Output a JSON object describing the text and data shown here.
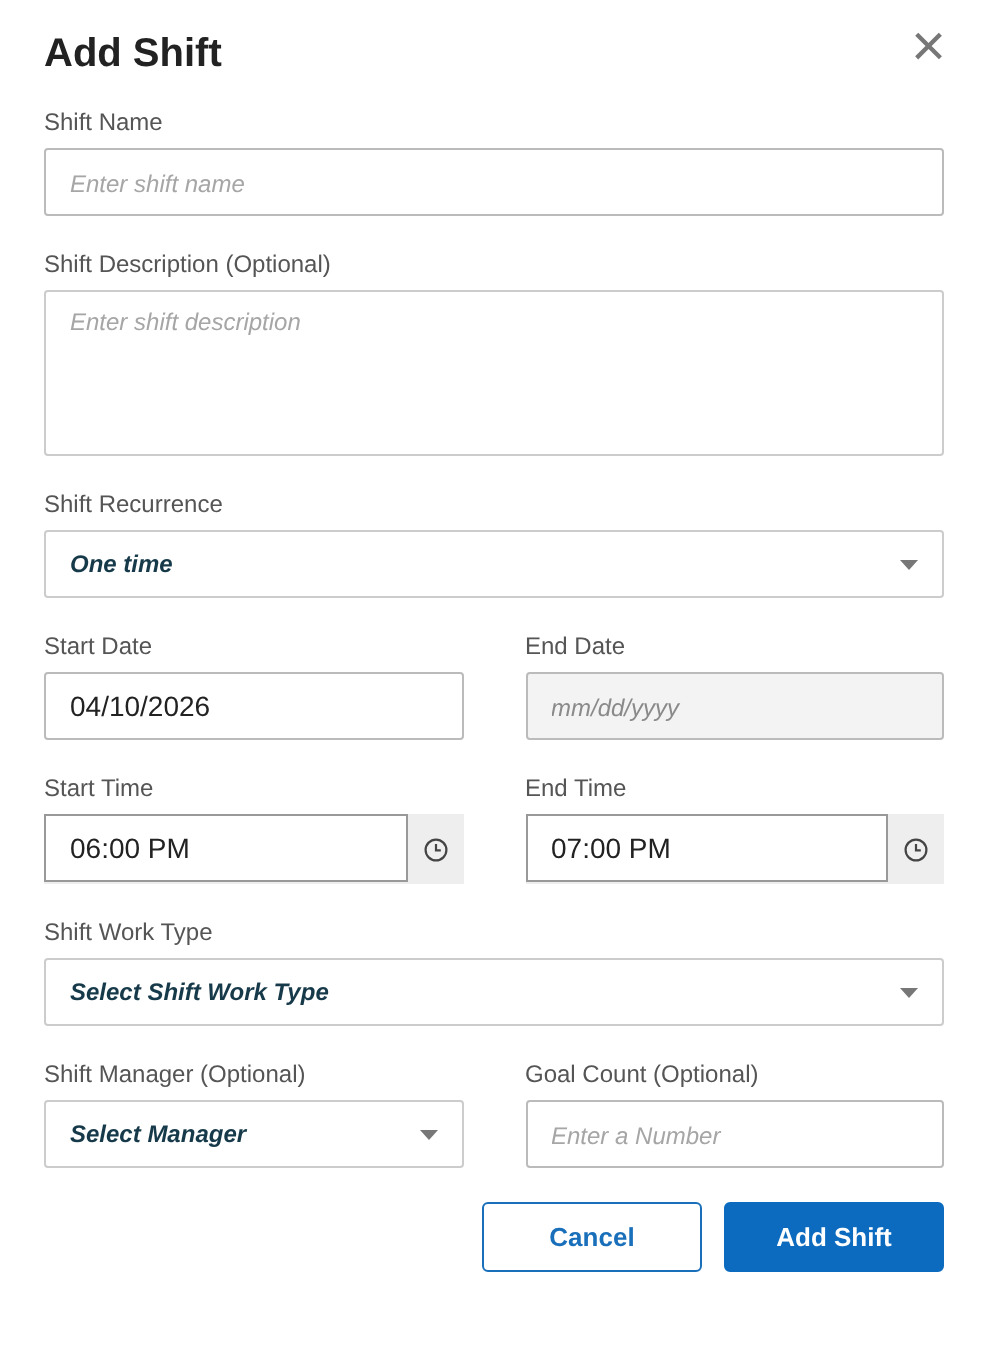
{
  "dialog": {
    "title": "Add Shift",
    "close": "×"
  },
  "rows": [
    {
      "fields": [
        {
          "label": "Shift Name",
          "kind": "text",
          "placeholder": "Enter shift name",
          "disabled": false
        }
      ]
    },
    {
      "fields": [
        {
          "label": "Shift Description (Optional)",
          "kind": "textarea",
          "placeholder": "Enter shift description",
          "disabled": false
        }
      ]
    },
    {
      "fields": [
        {
          "label": "Shift Recurrence",
          "kind": "select",
          "value": "One time",
          "disabled": false
        }
      ]
    },
    {
      "fields": [
        {
          "label": "Start Date",
          "kind": "date",
          "value": "04/10/2026",
          "disabled": false
        },
        {
          "label": "End Date",
          "kind": "date",
          "placeholder": "mm/dd/yyyy",
          "disabled": true
        }
      ]
    },
    {
      "fields": [
        {
          "label": "Start Time",
          "kind": "time",
          "value": "06:00 PM",
          "disabled": false
        },
        {
          "label": "End Time",
          "kind": "time",
          "value": "07:00 PM",
          "disabled": false
        }
      ]
    },
    {
      "fields": [
        {
          "label": "Shift Work Type",
          "kind": "select",
          "value": "Select Shift Work Type",
          "disabled": false
        }
      ]
    },
    {
      "fields": [
        {
          "label": "Shift Manager (Optional)",
          "kind": "select",
          "value": "Select Manager",
          "disabled": false
        },
        {
          "label": "Goal Count (Optional)",
          "kind": "text",
          "placeholder": "Enter a Number",
          "disabled": false
        }
      ]
    }
  ],
  "buttons": [
    {
      "label": "Cancel",
      "kind": "secondary"
    },
    {
      "label": "Add Shift",
      "kind": "primary"
    }
  ]
}
